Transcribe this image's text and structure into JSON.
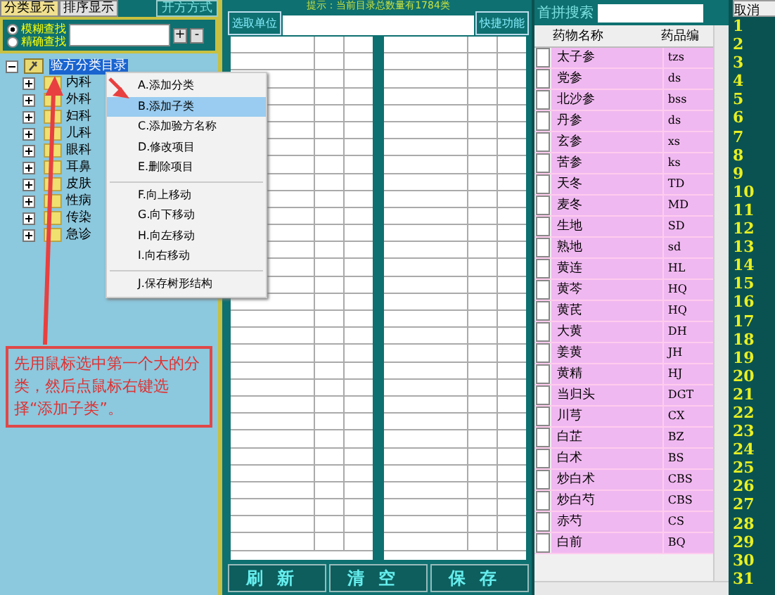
{
  "tabs": [
    {
      "label": "分类显示",
      "selected": true
    },
    {
      "label": "排序显示",
      "selected": false
    }
  ],
  "method_button": "开方方式",
  "search_modes": [
    {
      "label": "模糊查找",
      "selected": true
    },
    {
      "label": "精确查找",
      "selected": false
    }
  ],
  "zoom_buttons": [
    "+",
    "-"
  ],
  "tree": {
    "label": "验方分类目录",
    "selected": true,
    "expanded": true,
    "children": [
      {
        "label": "内科",
        "expanded": false
      },
      {
        "label": "外科",
        "expanded": false
      },
      {
        "label": "妇科",
        "expanded": false
      },
      {
        "label": "儿科",
        "expanded": false
      },
      {
        "label": "眼科",
        "expanded": false
      },
      {
        "label": "耳鼻",
        "expanded": false
      },
      {
        "label": "皮肤",
        "expanded": false
      },
      {
        "label": "性病",
        "expanded": false
      },
      {
        "label": "传染",
        "expanded": false
      },
      {
        "label": "急诊",
        "expanded": false
      }
    ]
  },
  "context_menu": {
    "groups": [
      {
        "items": [
          {
            "label": "A.添加分类",
            "selected": false
          },
          {
            "label": "B.添加子类",
            "selected": true
          },
          {
            "label": "C.添加验方名称",
            "selected": false
          },
          {
            "label": "D.修改项目",
            "selected": false
          },
          {
            "label": "E.删除项目",
            "selected": false
          }
        ]
      },
      {
        "items": [
          {
            "label": "F.向上移动",
            "selected": false
          },
          {
            "label": "G.向下移动",
            "selected": false
          },
          {
            "label": "H.向左移动",
            "selected": false
          },
          {
            "label": "I.向右移动",
            "selected": false
          }
        ]
      },
      {
        "items": [
          {
            "label": "J.保存树形结构",
            "selected": false
          }
        ]
      }
    ]
  },
  "annotation": "先用鼠标选中第一个大的分类，然后点鼠标右键选择“添加子类”。",
  "hint": "提示：当前目录总数量有1784类",
  "unit_button": "选取单位",
  "quick_button": "快捷功能",
  "actions": [
    "刷新",
    "清空",
    "保存"
  ],
  "search_label": "首拼搜索",
  "drug_table": {
    "columns": [
      "药物名称",
      "药品编"
    ],
    "rows": [
      {
        "name": "太子参",
        "code": "tzs",
        "checked": false
      },
      {
        "name": "党参",
        "code": "ds",
        "checked": false
      },
      {
        "name": "北沙参",
        "code": "bss",
        "checked": false
      },
      {
        "name": "丹参",
        "code": "ds",
        "checked": false
      },
      {
        "name": "玄参",
        "code": "xs",
        "checked": false
      },
      {
        "name": "苦参",
        "code": "ks",
        "checked": false
      },
      {
        "name": "天冬",
        "code": "TD",
        "checked": false
      },
      {
        "name": "麦冬",
        "code": "MD",
        "checked": false
      },
      {
        "name": "生地",
        "code": "SD",
        "checked": false
      },
      {
        "name": "熟地",
        "code": "sd",
        "checked": false
      },
      {
        "name": "黄连",
        "code": "HL",
        "checked": false
      },
      {
        "name": "黄芩",
        "code": "HQ",
        "checked": false
      },
      {
        "name": "黄芪",
        "code": "HQ",
        "checked": false
      },
      {
        "name": "大黄",
        "code": "DH",
        "checked": false
      },
      {
        "name": "姜黄",
        "code": "JH",
        "checked": false
      },
      {
        "name": "黄精",
        "code": "HJ",
        "checked": false
      },
      {
        "name": "当归头",
        "code": "DGT",
        "checked": false
      },
      {
        "name": "川芎",
        "code": "CX",
        "checked": false
      },
      {
        "name": "白芷",
        "code": "BZ",
        "checked": false
      },
      {
        "name": "白术",
        "code": "BS",
        "checked": false
      },
      {
        "name": "炒白术",
        "code": "CBS",
        "checked": false
      },
      {
        "name": "炒白芍",
        "code": "CBS",
        "checked": false
      },
      {
        "name": "赤芍",
        "code": "CS",
        "checked": false
      },
      {
        "name": "白前",
        "code": "BQ",
        "checked": false
      }
    ]
  },
  "cancel_button": "取消",
  "line_numbers": [
    "1",
    "2",
    "3",
    "4",
    "5",
    "6",
    "7",
    "8",
    "9",
    "10",
    "11",
    "12",
    "13",
    "14",
    "15",
    "16",
    "17",
    "18",
    "19",
    "20",
    "21",
    "22",
    "23",
    "24",
    "25",
    "26",
    "27",
    "28",
    "29",
    "30",
    "31"
  ]
}
